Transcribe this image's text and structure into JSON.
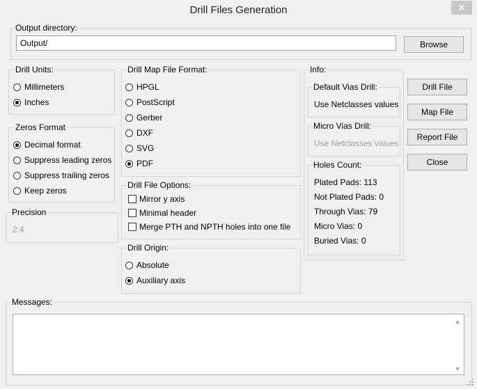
{
  "window": {
    "title": "Drill Files Generation",
    "close_glyph": "✕"
  },
  "output": {
    "label": "Output directory:",
    "value": "Output/",
    "browse": "Browse"
  },
  "units": {
    "label": "Drill Units:",
    "options": [
      "Millimeters",
      "Inches"
    ],
    "selected": 1
  },
  "zeros": {
    "label": "Zeros Format",
    "options": [
      "Decimal format",
      "Suppress leading zeros",
      "Suppress trailing zeros",
      "Keep zeros"
    ],
    "selected": 0
  },
  "precision": {
    "label": "Precision",
    "value": "2:4"
  },
  "map_format": {
    "label": "Drill Map File Format:",
    "options": [
      "HPGL",
      "PostScript",
      "Gerber",
      "DXF",
      "SVG",
      "PDF"
    ],
    "selected": 5
  },
  "file_options": {
    "label": "Drill File Options:",
    "options": [
      "Mirror y axis",
      "Minimal header",
      "Merge PTH and NPTH holes into one file"
    ],
    "checked": [
      false,
      false,
      false
    ]
  },
  "origin": {
    "label": "Drill Origin:",
    "options": [
      "Absolute",
      "Auxiliary axis"
    ],
    "selected": 1
  },
  "info": {
    "label": "Info:",
    "default_vias": {
      "label": "Default Vias Drill:",
      "value": "Use Netclasses values"
    },
    "micro_vias": {
      "label": "Micro Vias Drill:",
      "value": "Use Netclasses values"
    },
    "holes": {
      "label": "Holes Count:",
      "plated_pads": "Plated Pads: 113",
      "not_plated_pads": "Not Plated Pads: 0",
      "through_vias": "Through Vias: 79",
      "micro_vias": "Micro Vias: 0",
      "buried_vias": "Buried Vias: 0"
    }
  },
  "buttons": {
    "drill_file": "Drill File",
    "map_file": "Map File",
    "report_file": "Report File",
    "close": "Close"
  },
  "messages": {
    "label": "Messages:",
    "text": ""
  },
  "icons": {
    "close": "close-icon",
    "scroll_up": "scroll-up-arrow-icon",
    "scroll_down": "scroll-down-arrow-icon",
    "resize": "resize-grip-icon"
  }
}
